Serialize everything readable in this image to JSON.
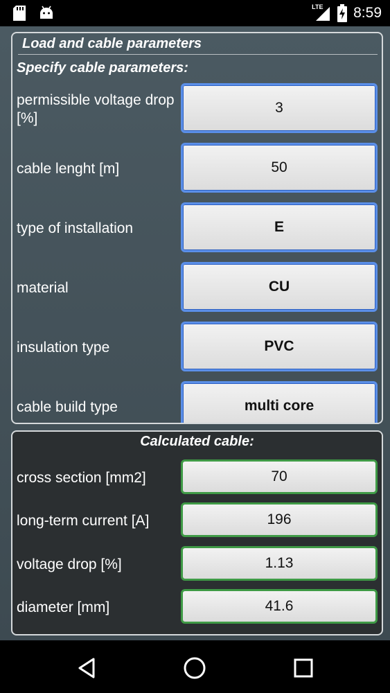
{
  "status_bar": {
    "time": "8:59",
    "network": "LTE",
    "icons": [
      "sd-card-icon",
      "android-icon",
      "signal-icon",
      "battery-charging-icon"
    ]
  },
  "top_panel": {
    "title": "Load and cable parameters",
    "heading": "Specify cable parameters:",
    "rows": [
      {
        "label": "permissible voltage drop [%]",
        "value": "3"
      },
      {
        "label": "cable lenght [m]",
        "value": "50"
      },
      {
        "label": "type of installation",
        "value": "E"
      },
      {
        "label": "material",
        "value": "CU"
      },
      {
        "label": "insulation type",
        "value": "PVC"
      },
      {
        "label": "cable build type",
        "value": "multi core"
      }
    ]
  },
  "bottom_panel": {
    "heading": "Calculated cable:",
    "rows": [
      {
        "label": "cross section [mm2]",
        "value": "70"
      },
      {
        "label": "long-term current [A]",
        "value": "196"
      },
      {
        "label": "voltage drop [%]",
        "value": "1.13"
      },
      {
        "label": "diameter [mm]",
        "value": "41.6"
      }
    ]
  },
  "nav_bar": {
    "buttons": [
      "back-icon",
      "home-icon",
      "recents-icon"
    ]
  },
  "colors": {
    "input_border": "#5b8fe8",
    "result_border": "#3f9a46",
    "panel_border": "#d5d9db"
  }
}
